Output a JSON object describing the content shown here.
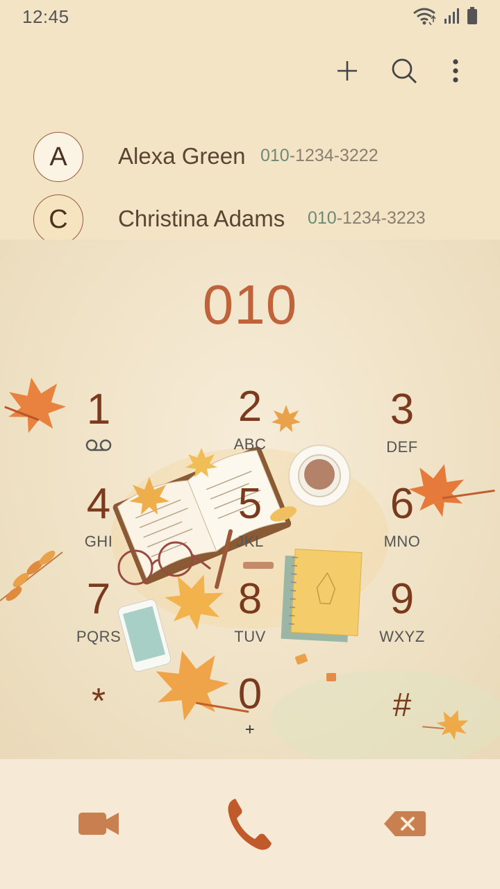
{
  "status_bar": {
    "time": "12:45",
    "icons": [
      "wifi-icon",
      "signal-icon",
      "battery-icon"
    ]
  },
  "app_bar": {
    "actions": [
      "add-icon",
      "search-icon",
      "more-icon"
    ]
  },
  "contacts": [
    {
      "initial": "A",
      "name": "Alexa Green",
      "number_match": "010",
      "number_rest": "-1234-3222"
    },
    {
      "initial": "C",
      "name": "Christina Adams",
      "number_match": "010",
      "number_rest": "-1234-3223"
    }
  ],
  "dialer": {
    "entered_number": "010",
    "keys": [
      {
        "digit": "1",
        "letters": ""
      },
      {
        "digit": "2",
        "letters": "ABC"
      },
      {
        "digit": "3",
        "letters": "DEF"
      },
      {
        "digit": "4",
        "letters": "GHI"
      },
      {
        "digit": "5",
        "letters": "JKL"
      },
      {
        "digit": "6",
        "letters": "MNO"
      },
      {
        "digit": "7",
        "letters": "PQRS"
      },
      {
        "digit": "8",
        "letters": "TUV"
      },
      {
        "digit": "9",
        "letters": "WXYZ"
      },
      {
        "digit": "*",
        "letters": ""
      },
      {
        "digit": "0",
        "letters": "+"
      },
      {
        "digit": "#",
        "letters": ""
      }
    ]
  },
  "bottom_bar": {
    "actions": [
      "video-call-icon",
      "call-icon",
      "backspace-icon"
    ]
  },
  "colors": {
    "background": "#f2e4c4",
    "accent": "#c0623a",
    "digit": "#7a3a1e",
    "icon": "#c98050"
  }
}
